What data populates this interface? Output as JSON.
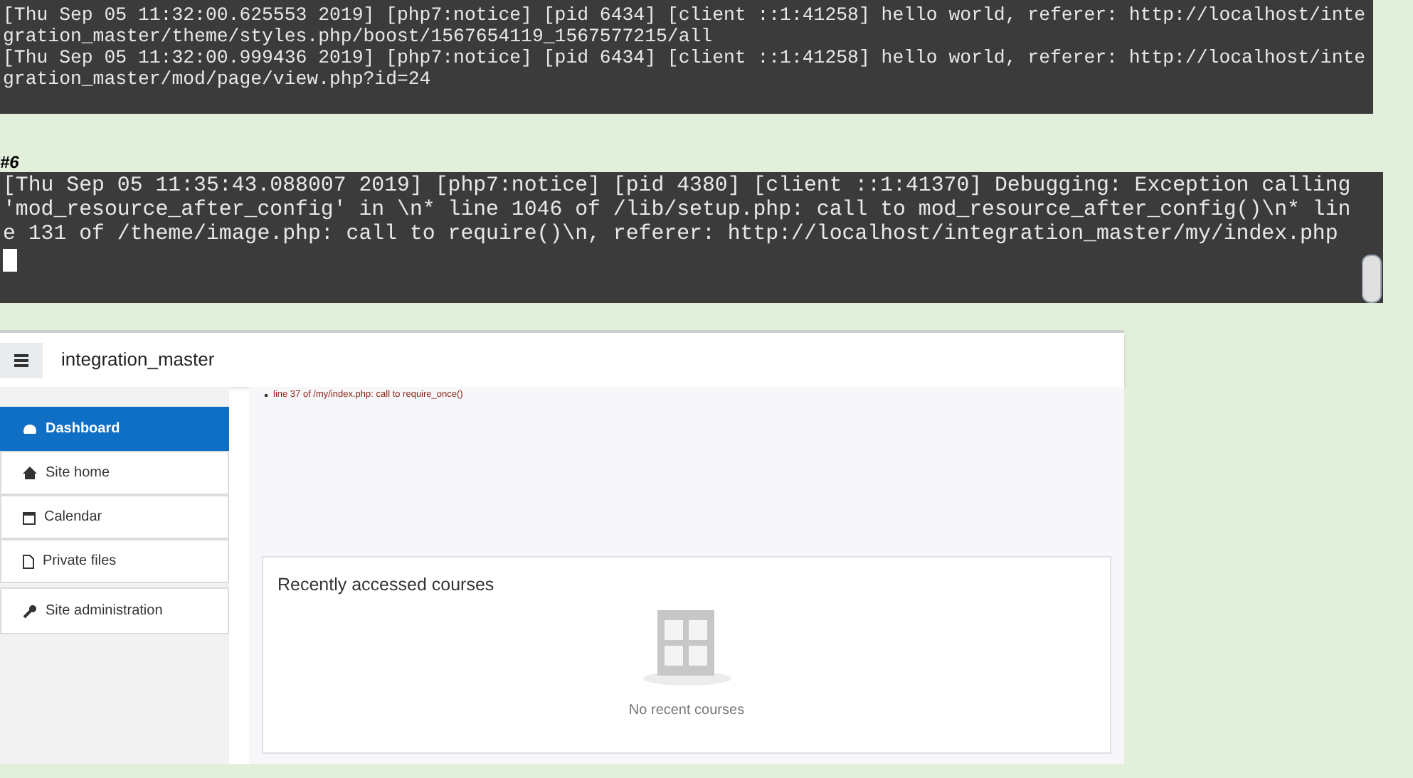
{
  "terminal_top": {
    "entries": [
      "[Thu Sep 05 11:32:00.625553 2019] [php7:notice] [pid 6434] [client ::1:41258] hello world, referer: http://localhost/integration_master/theme/styles.php/boost/1567654119_1567577215/all",
      "[Thu Sep 05 11:32:00.999436 2019] [php7:notice] [pid 6434] [client ::1:41258] hello world, referer: http://localhost/integration_master/mod/page/view.php?id=24"
    ]
  },
  "label": "#6",
  "terminal_bottom": {
    "entries": [
      "[Thu Sep 05 11:35:43.088007 2019] [php7:notice] [pid 4380] [client ::1:41370] Debugging: Exception calling 'mod_resource_after_config' in \\n* line 1046 of /lib/setup.php: call to mod_resource_after_config()\\n* line 131 of /theme/image.php: call to require()\\n, referer: http://localhost/integration_master/my/index.php"
    ]
  },
  "browser": {
    "site_name": "integration_master",
    "debug_line": "line 37 of /my/index.php: call to require_once()",
    "nav": [
      {
        "label": "Dashboard",
        "selected": true
      },
      {
        "label": "Site home",
        "selected": false
      },
      {
        "label": "Calendar",
        "selected": false
      },
      {
        "label": "Private files",
        "selected": false
      },
      {
        "label": "Site administration",
        "selected": false
      }
    ],
    "card": {
      "title": "Recently accessed courses",
      "empty_text": "No recent courses"
    }
  }
}
